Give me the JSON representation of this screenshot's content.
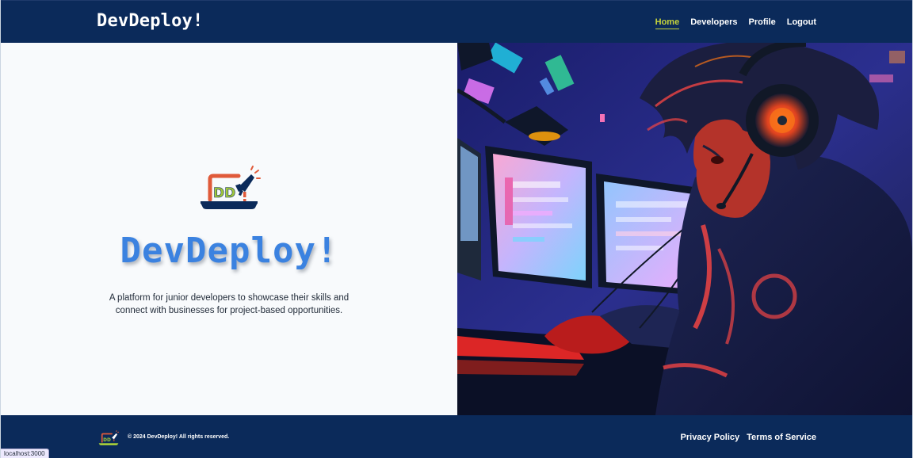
{
  "header": {
    "brand": "DevDeploy!",
    "nav": [
      {
        "label": "Home",
        "active": true
      },
      {
        "label": "Developers",
        "active": false
      },
      {
        "label": "Profile",
        "active": false
      },
      {
        "label": "Logout",
        "active": false
      }
    ]
  },
  "hero": {
    "logo_icon": "devdeploy-megaphone-logo",
    "title": "DevDeploy!",
    "description": "A platform for junior developers to showcase their skills and connect with businesses for project-based opportunities.",
    "image_icon": "anime-developer-at-computer-illustration"
  },
  "footer": {
    "logo_icon": "devdeploy-megaphone-logo",
    "copyright": "© 2024 DevDeploy! All rights reserved.",
    "links": [
      "Privacy Policy",
      "Terms of Service"
    ]
  },
  "status_bar": {
    "url": "localhost:3000"
  },
  "colors": {
    "navy": "#0b2a5a",
    "accent_active": "#c7d53b",
    "title_blue": "#3b82e0",
    "background": "#f8fafc"
  }
}
